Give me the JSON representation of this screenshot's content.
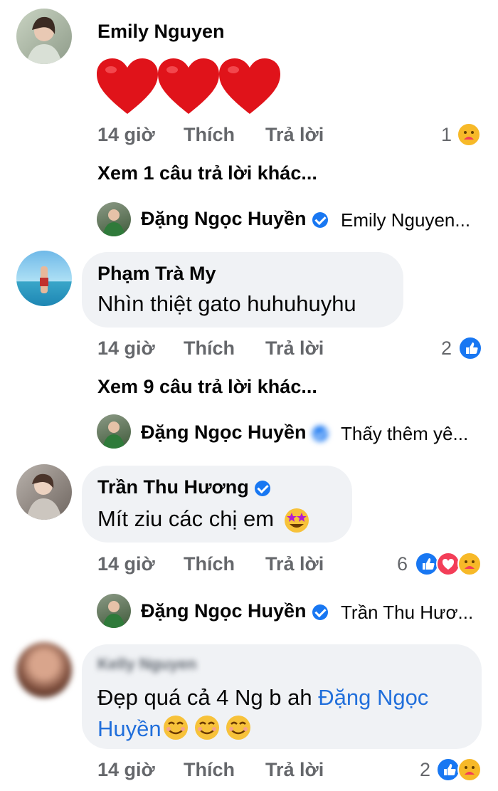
{
  "comments": [
    {
      "author": "Emily Nguyen",
      "message": "",
      "time": "14 giờ",
      "like_label": "Thích",
      "reply_label": "Trả lời",
      "reaction_count": "1",
      "more_replies": "Xem 1 câu trả lời khác...",
      "reply_author": "Đặng Ngọc Huyền",
      "reply_preview": "Emily Nguyen..."
    },
    {
      "author": "Phạm Trà My",
      "message": "Nhìn thiệt gato huhuhuyhu",
      "time": "14 giờ",
      "like_label": "Thích",
      "reply_label": "Trả lời",
      "reaction_count": "2",
      "more_replies": "Xem 9 câu trả lời khác...",
      "reply_author": "Đặng Ngọc Huyền",
      "reply_preview": "Thấy thêm yê..."
    },
    {
      "author": "Trần Thu Hương",
      "message": "Mít ziu các chị em",
      "time": "14 giờ",
      "like_label": "Thích",
      "reply_label": "Trả lời",
      "reaction_count": "6",
      "reply_author": "Đặng Ngọc Huyền",
      "reply_preview": "Trần Thu Hươ..."
    },
    {
      "author": "Kelly Nguyen",
      "message_line1": "Đẹp quá cả 4 Ng b ah ",
      "mention_part1": "Đặng Ngọc",
      "mention_part2": "Huyền",
      "time": "14 giờ",
      "like_label": "Thích",
      "reply_label": "Trả lời",
      "reaction_count": "2"
    }
  ],
  "colors": {
    "bubble": "#f0f2f5",
    "meta_text": "#65676b",
    "like_blue": "#1877f2",
    "love_red": "#f33e58",
    "mention": "#216fdb"
  },
  "icons": [
    "heart-emoji",
    "care-reaction-icon",
    "like-reaction-icon",
    "love-reaction-icon",
    "star-struck-emoji",
    "smiling-emoji",
    "verified-badge-icon"
  ]
}
